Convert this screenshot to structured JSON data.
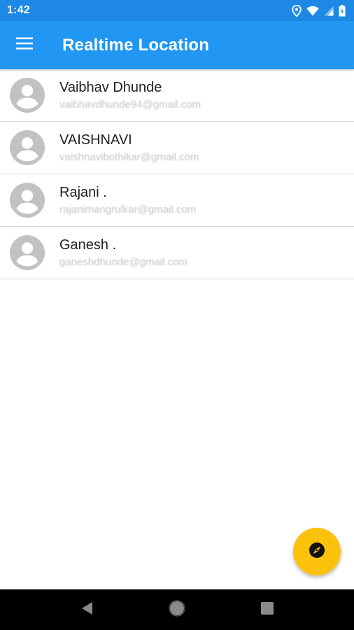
{
  "status_bar": {
    "time": "1:42",
    "icons": [
      "location-icon",
      "wifi-icon",
      "signal-icon",
      "battery-icon"
    ]
  },
  "app_bar": {
    "title": "Realtime Location",
    "menu_icon": "hamburger-menu-icon"
  },
  "contacts": [
    {
      "name": "Vaibhav Dhunde",
      "email": "vaibhavdhunde94@gmail.com"
    },
    {
      "name": "VAISHNAVI",
      "email": "vaishnavibothikar@gmail.com"
    },
    {
      "name": "Rajani .",
      "email": "rajanimangrulkar@gmail.com"
    },
    {
      "name": "Ganesh .",
      "email": "ganeshdhunde@gmail.com"
    }
  ],
  "fab": {
    "icon": "compass-icon"
  },
  "nav_bar": {
    "icons": [
      "back-icon",
      "home-icon",
      "recents-icon"
    ]
  },
  "colors": {
    "status_bar": "#1e88e5",
    "app_bar": "#2196f3",
    "fab": "#fcc10b",
    "avatar": "#c2c2c2"
  }
}
